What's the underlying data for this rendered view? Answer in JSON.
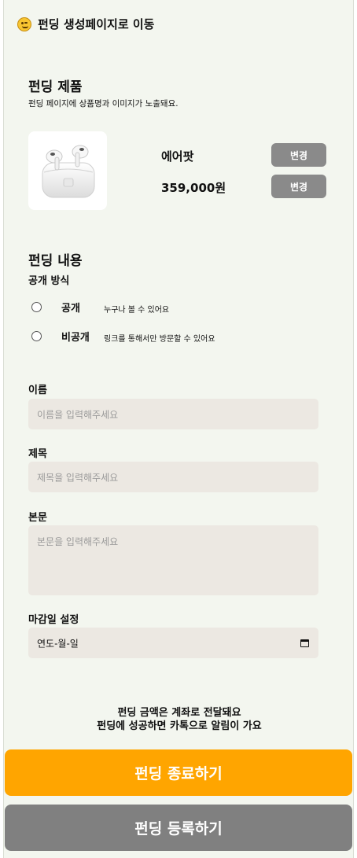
{
  "back_link": {
    "label": "펀딩 생성페이지로 이동",
    "icon": "wink-emoji-icon"
  },
  "product_section": {
    "title": "펀딩 제품",
    "description": "펀딩 페이지에 상품명과 이미지가 노출돼요.",
    "product_name": "에어팟",
    "product_price": "359,000원",
    "change_name_label": "변경",
    "change_price_label": "변경"
  },
  "content_section": {
    "title": "펀딩 내용",
    "visibility_label": "공개 방식",
    "options": [
      {
        "label": "공개",
        "description": "누구나 볼 수 있어요"
      },
      {
        "label": "비공개",
        "description": "링크를 통해서만 방문할 수 있어요"
      }
    ]
  },
  "form": {
    "name_label": "이름",
    "name_placeholder": "이름을 입력해주세요",
    "title_label": "제목",
    "title_placeholder": "제목을 입력해주세요",
    "body_label": "본문",
    "body_placeholder": "본문을 입력해주세요",
    "deadline_label": "마감일 설정",
    "deadline_value": "연도-월-일"
  },
  "notice": {
    "line1": "펀딩 금액은 계좌로 전달돼요",
    "line2": "펀딩에 성공하면 카톡으로 알림이 가요"
  },
  "buttons": {
    "end_label": "펀딩 종료하기",
    "register_label": "펀딩 등록하기"
  },
  "colors": {
    "background": "#f3f6ef",
    "change_button": "#8a8a8a",
    "end_button": "#ffa500",
    "register_button": "#808080",
    "input_bg": "#ece8e2"
  }
}
